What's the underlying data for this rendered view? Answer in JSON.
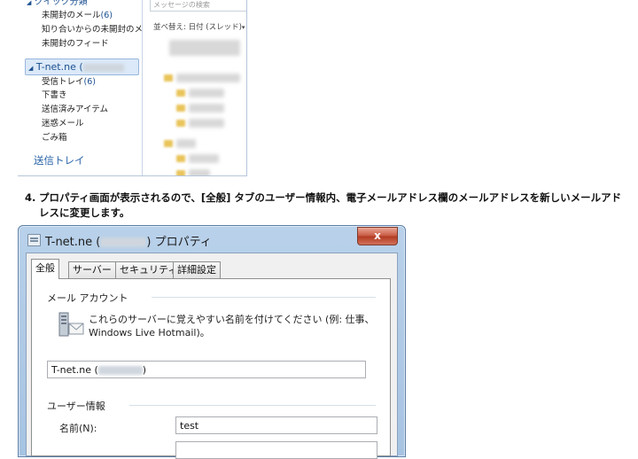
{
  "mail_client": {
    "quick_views_label": "クイック分類",
    "quick_views": [
      {
        "label": "未開封のメール",
        "count": "(6)"
      },
      {
        "label": "知り合いからの未開封のメ...",
        "count": ""
      },
      {
        "label": "未開封のフィード",
        "count": ""
      }
    ],
    "account_name": "T-net.ne (",
    "account_folders": [
      {
        "label": "受信トレイ",
        "count": "(6)"
      },
      {
        "label": "下書き",
        "count": ""
      },
      {
        "label": "送信済みアイテム",
        "count": ""
      },
      {
        "label": "迷惑メール",
        "count": ""
      },
      {
        "label": "ごみ箱",
        "count": ""
      }
    ],
    "outbox_label": "送信トレイ",
    "search_placeholder": "メッセージの検索",
    "sort_label": "並べ替え: 日付 (スレッド)"
  },
  "step": {
    "number": "4.",
    "text": "プロパティ画面が表示されるので、[全般] タブのユーザー情報内、電子メールアドレス欄のメールアドレスを新しいメールアドレスに変更します。"
  },
  "dialog": {
    "title_prefix": "T-net.ne (",
    "title_suffix": ") プロパティ",
    "close_glyph": "x",
    "tabs": [
      "全般",
      "サーバー",
      "セキュリティ",
      "詳細設定"
    ],
    "mail_account_label": "メール アカウント",
    "mail_account_desc_line1": "これらのサーバーに覚えやすい名前を付けてください (例: 仕事、",
    "mail_account_desc_line2": "Windows Live Hotmail)。",
    "account_name_prefix": "T-net.ne (",
    "account_name_suffix": ")",
    "user_info_label": "ユーザー情報",
    "name_label": "名前(N):",
    "name_value": "test"
  }
}
